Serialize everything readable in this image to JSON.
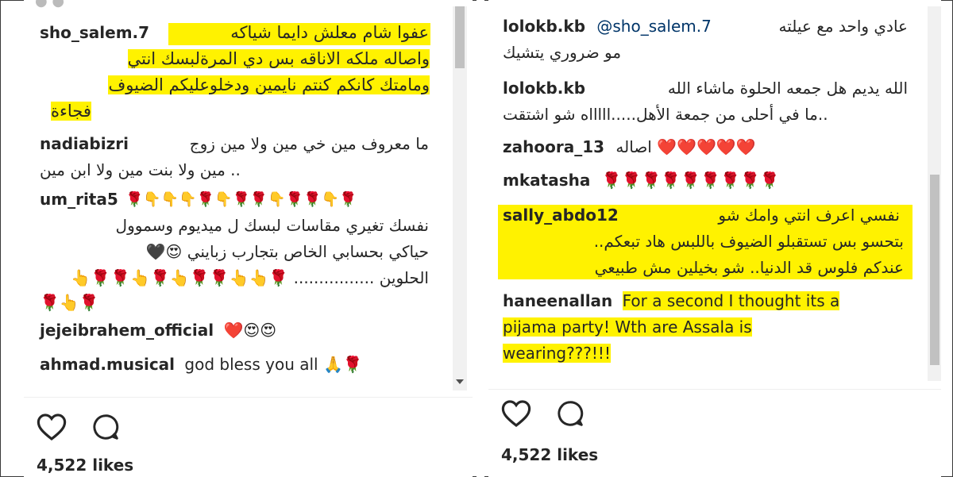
{
  "left": {
    "comments": [
      {
        "user": "sho_salem.7",
        "lines": [
          "عفوا شام معلش دايما شياكه",
          "واصاله ملكه الاناقه بس دي المرةلبسك انتي",
          "ومامتك كانكم كنتم نايمين ودخلوعليكم الضيوف",
          "فجاءة"
        ],
        "highlight": true
      },
      {
        "user": "nadiabizri",
        "lines": [
          "ما معروف مين خي مين ولا مين زوج",
          ".. مين ولا بنت مين ولا ابن مين"
        ],
        "highlight": false
      },
      {
        "user": "um_rita5",
        "emoji": "🌹👇👇👇🌹👇🌹🌹👇🌹🌹👇🌹",
        "lines": [
          "نفسك تغيري مقاسات لبسك ل ميديوم وسموول",
          "حياكي بحسابي الخاص بتجارب زبايني 😍🖤",
          "الحلوين ................ 🌹👆👆🌹🌹👆🌹👆🌹🌹👆",
          "🌹👆🌹"
        ],
        "highlight": false
      },
      {
        "user": "jejeibrahem_official",
        "text": "❤️😍😍",
        "highlight": false
      },
      {
        "user": "ahmad.musical",
        "text": "god bless you all 🙏🌹",
        "highlight": false
      }
    ],
    "likes": "4,522 likes"
  },
  "right": {
    "comments": [
      {
        "user": "lolokb.kb",
        "mention": "@sho_salem.7",
        "lines": [
          "عادي واحد مع عيلته",
          "مو ضروري يتشيك"
        ]
      },
      {
        "user": "lolokb.kb",
        "lines": [
          "الله يديم هل جمعه الحلوة ماشاء الله",
          "..ما في أحلى من جمعة الأهل.....اااااه شو اشتقت"
        ]
      },
      {
        "user": "zahoora_13",
        "text": "اصاله ❤️❤️❤️❤️❤️"
      },
      {
        "user": "mkatasha",
        "text": "🌹🌹🌹🌹🌹🌹🌹🌹🌹"
      },
      {
        "user": "sally_abdo12",
        "lines": [
          "نفسي اعرف انتي وامك شو",
          "بتحسو بس تستقبلو الضيوف باللبس هاد تبعكم..",
          "عندكم فلوس قد الدنيا.. شو بخيلين مش طبيعي"
        ],
        "highlight": true
      },
      {
        "user": "haneenallan",
        "lines": [
          "For a second I thought its a",
          "pijama party! Wth are Assala is",
          "wearing???!!!"
        ],
        "highlight": true
      }
    ],
    "likes": "4,522 likes"
  },
  "icons": {
    "like": "heart-outline-icon",
    "comment": "comment-bubble-icon"
  }
}
